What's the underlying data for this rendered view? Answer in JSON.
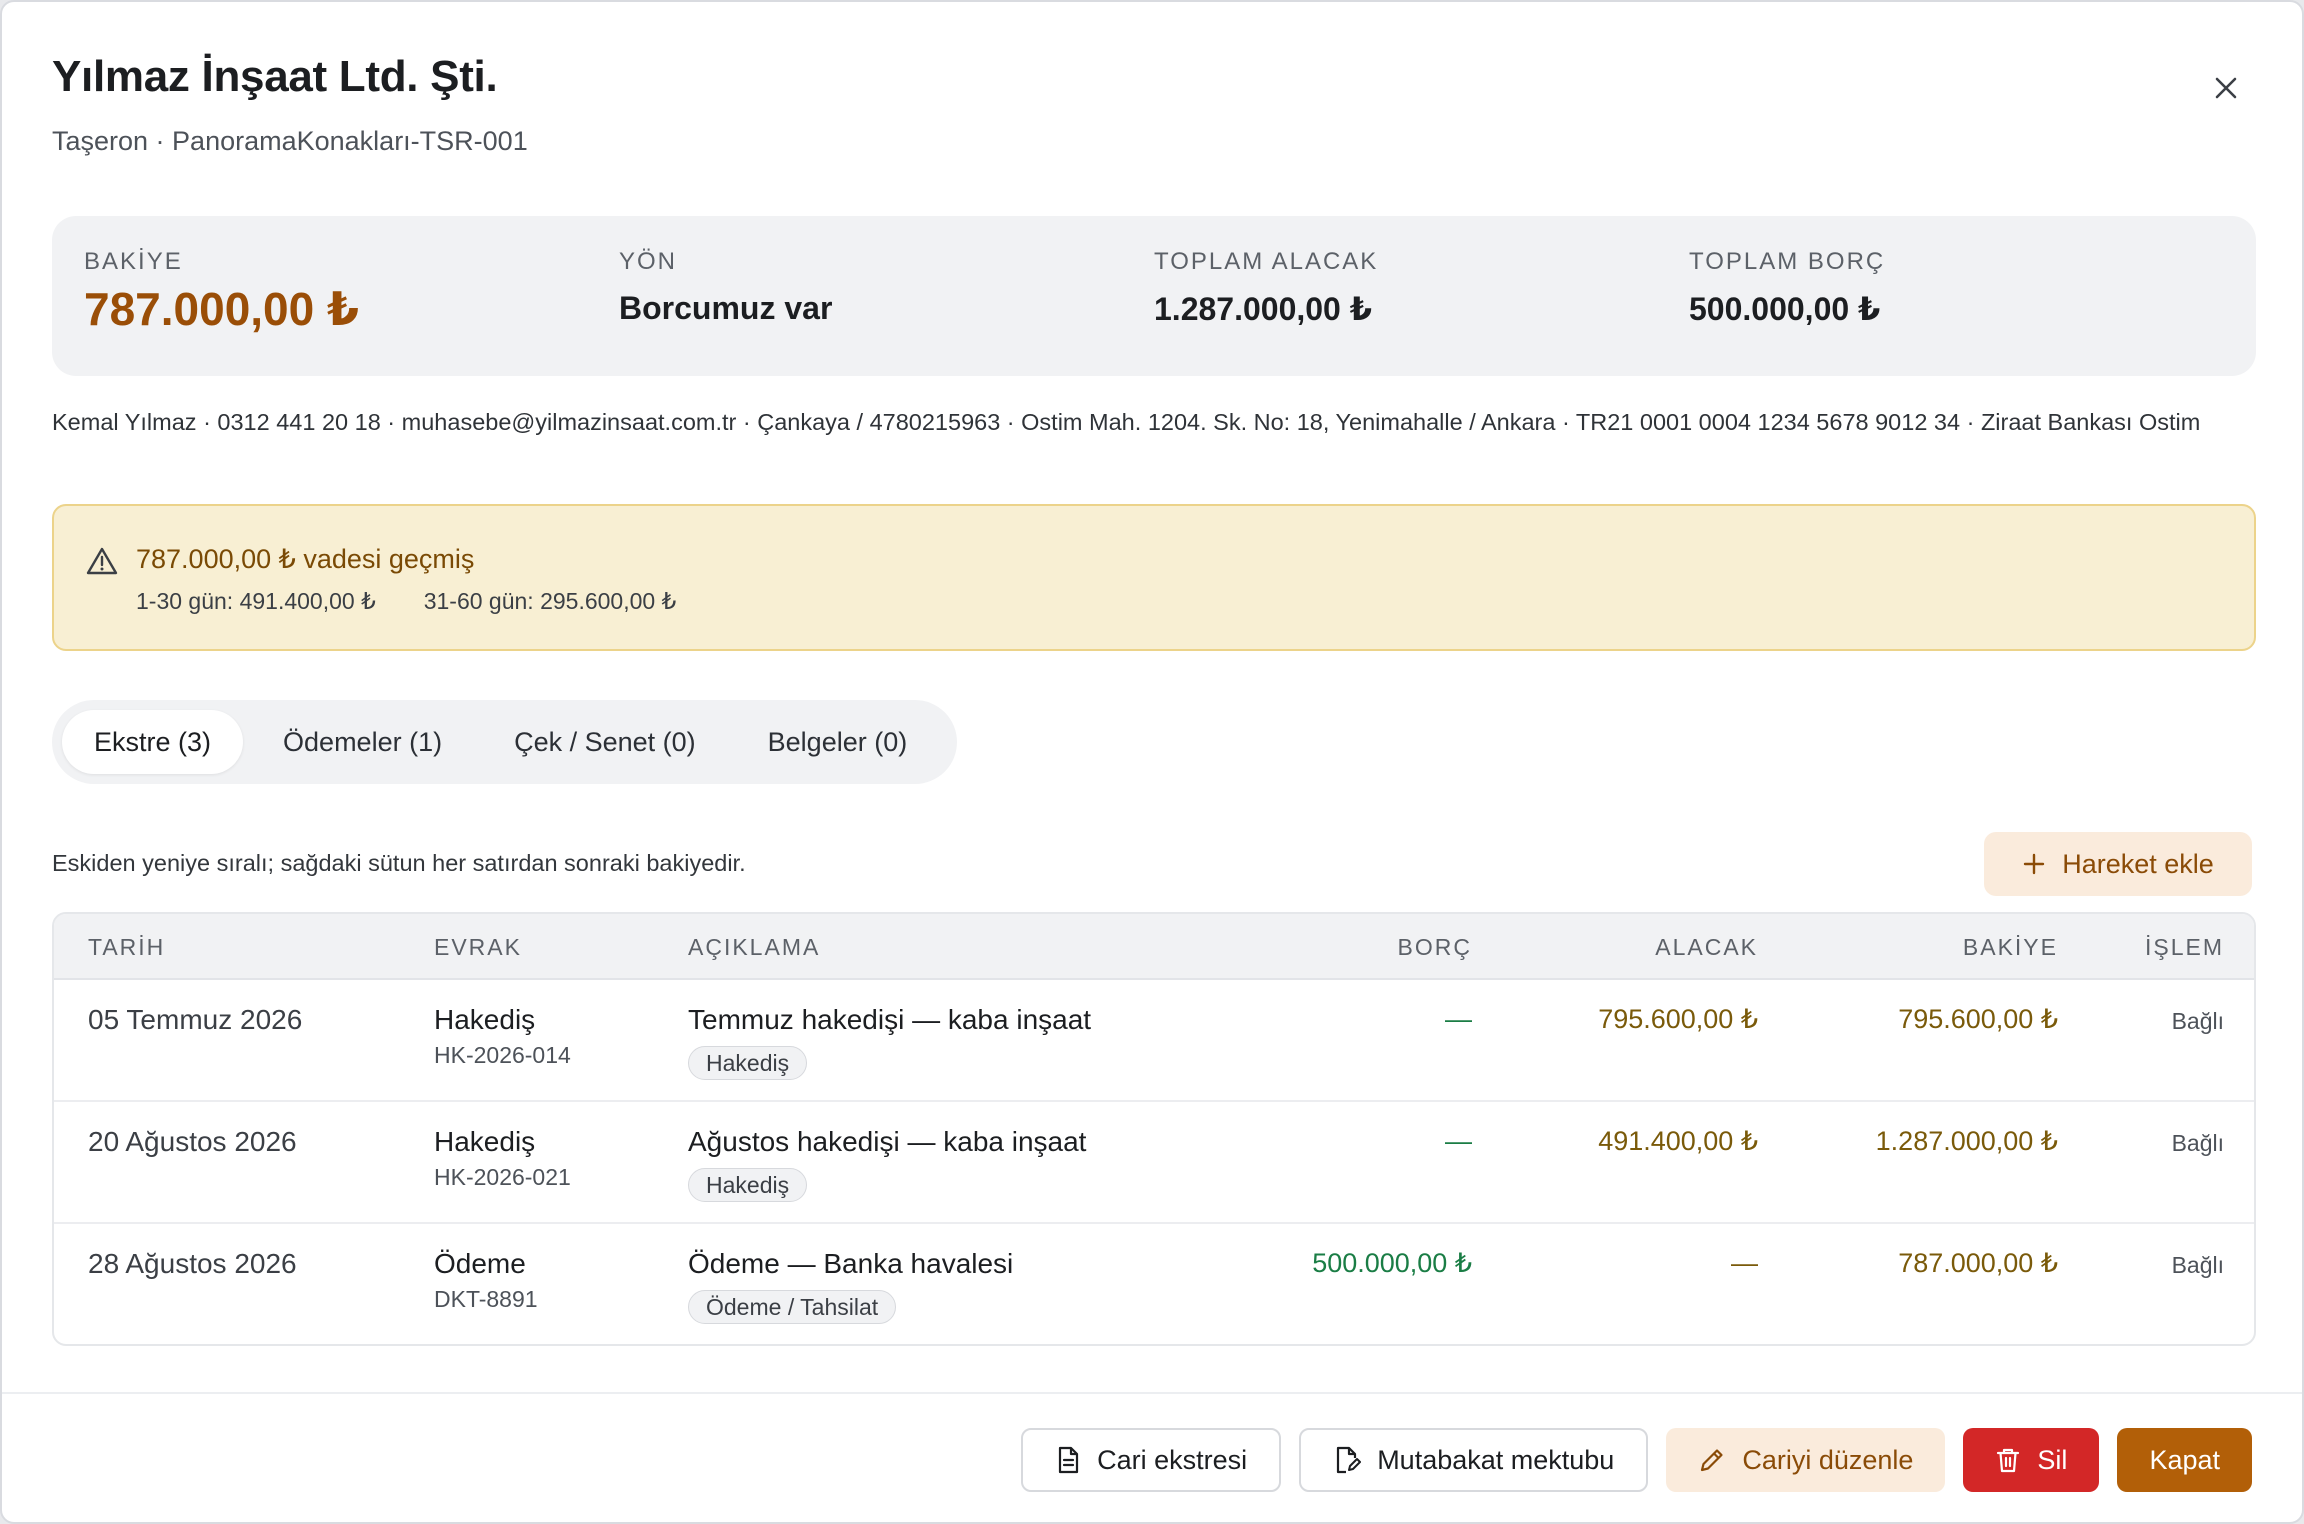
{
  "header": {
    "title": "Yılmaz İnşaat Ltd. Şti.",
    "subtitle": "Taşeron · PanoramaKonakları-TSR-001"
  },
  "summary": {
    "balance_label": "BAKİYE",
    "balance_value": "787.000,00 ₺",
    "direction_label": "YÖN",
    "direction_value": "Borcumuz var",
    "total_credit_label": "TOPLAM ALACAK",
    "total_credit_value": "1.287.000,00 ₺",
    "total_debit_label": "TOPLAM BORÇ",
    "total_debit_value": "500.000,00 ₺"
  },
  "contact": {
    "line": "Kemal Yılmaz · 0312 441 20 18 · muhasebe@yilmazinsaat.com.tr · Çankaya / 4780215963 · Ostim Mah. 1204. Sk. No: 18, Yenimahalle / Ankara · TR21 0001 0004 1234 5678 9012 34 · Ziraat Bankası Ostim"
  },
  "alert": {
    "title": "787.000,00 ₺ vadesi geçmiş",
    "bucket_1": "1-30 gün: 491.400,00 ₺",
    "bucket_2": "31-60 gün: 295.600,00 ₺"
  },
  "tabs": [
    {
      "label": "Ekstre (3)"
    },
    {
      "label": "Ödemeler (1)"
    },
    {
      "label": "Çek / Senet (0)"
    },
    {
      "label": "Belgeler (0)"
    }
  ],
  "hint": "Eskiden yeniye sıralı; sağdaki sütun her satırdan sonraki bakiyedir.",
  "add_button": "Hareket ekle",
  "table": {
    "headers": {
      "date": "TARİH",
      "doc": "EVRAK",
      "desc": "AÇIKLAMA",
      "borc": "BORÇ",
      "alacak": "ALACAK",
      "bakiye": "BAKİYE",
      "islem": "İŞLEM"
    },
    "rows": [
      {
        "date": "05 Temmuz 2026",
        "doc_type": "Hakediş",
        "doc_no": "HK-2026-014",
        "desc": "Temmuz hakedişi — kaba inşaat",
        "tag": "Hakediş",
        "borc": "—",
        "alacak": "795.600,00 ₺",
        "bakiye": "795.600,00 ₺",
        "islem": "Bağlı"
      },
      {
        "date": "20 Ağustos 2026",
        "doc_type": "Hakediş",
        "doc_no": "HK-2026-021",
        "desc": "Ağustos hakedişi — kaba inşaat",
        "tag": "Hakediş",
        "borc": "—",
        "alacak": "491.400,00 ₺",
        "bakiye": "1.287.000,00 ₺",
        "islem": "Bağlı"
      },
      {
        "date": "28 Ağustos 2026",
        "doc_type": "Ödeme",
        "doc_no": "DKT-8891",
        "desc": "Ödeme — Banka havalesi",
        "tag": "Ödeme / Tahsilat",
        "borc": "500.000,00 ₺",
        "alacak": "—",
        "bakiye": "787.000,00 ₺",
        "islem": "Bağlı"
      }
    ]
  },
  "footer": {
    "statement_button": "Cari ekstresi",
    "reconciliation_button": "Mutabakat mektubu",
    "edit_button": "Cariyi düzenle",
    "delete_button": "Sil",
    "close_button": "Kapat"
  },
  "colors": {
    "accent": "#b25f08",
    "danger": "#d32727",
    "alert_bg": "#f8efd3",
    "debit_green": "#1a7d45"
  },
  "icons": [
    "close-icon",
    "warning-icon",
    "plus-icon",
    "document-icon",
    "edit-document-icon",
    "pencil-icon",
    "trash-icon"
  ]
}
